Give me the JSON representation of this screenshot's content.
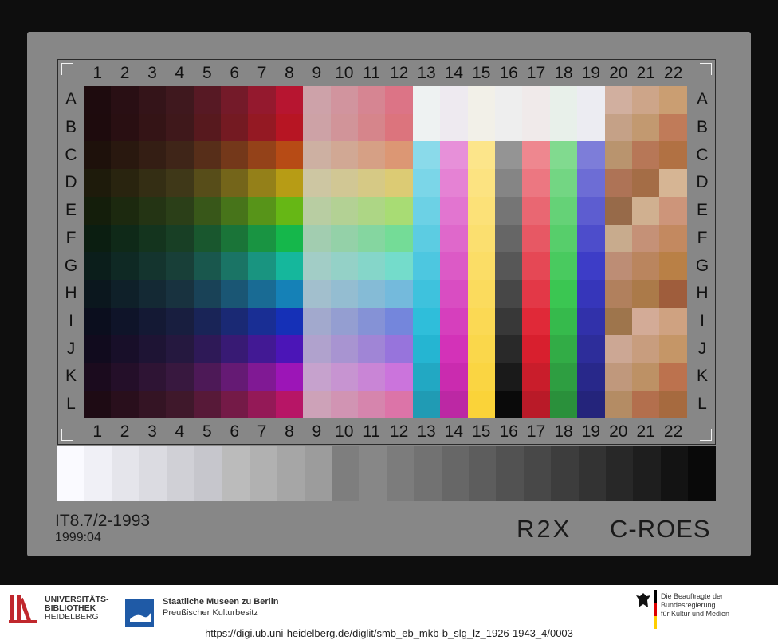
{
  "target": {
    "columns": [
      "1",
      "2",
      "3",
      "4",
      "5",
      "6",
      "7",
      "8",
      "9",
      "10",
      "11",
      "12",
      "13",
      "14",
      "15",
      "16",
      "17",
      "18",
      "19",
      "20",
      "21",
      "22"
    ],
    "rows": [
      "A",
      "B",
      "C",
      "D",
      "E",
      "F",
      "G",
      "H",
      "I",
      "J",
      "K",
      "L"
    ],
    "id": "IT8.7/2-1993",
    "date": "1999:04",
    "code_left": "R2X",
    "code_right": "C-ROES"
  },
  "footer": {
    "heidelberg_l1": "UNIVERSITÄTS-",
    "heidelberg_l2": "BIBLIOTHEK",
    "heidelberg_l3": "HEIDELBERG",
    "smb_l1": "Staatliche Museen zu Berlin",
    "smb_l2": "Preußischer Kulturbesitz",
    "bkm_l1": "Die Beauftragte der Bundesregierung",
    "bkm_l2": "für Kultur und Medien",
    "url": "https://digi.ub.uni-heidelberg.de/diglit/smb_eb_mkb-b_slg_lz_1926-1943_4/0003"
  },
  "colors": {
    "background": "#0e0e0e",
    "card": "#878787",
    "heidelberg_red": "#c0282d",
    "smb_blue": "#1f5aa6"
  }
}
